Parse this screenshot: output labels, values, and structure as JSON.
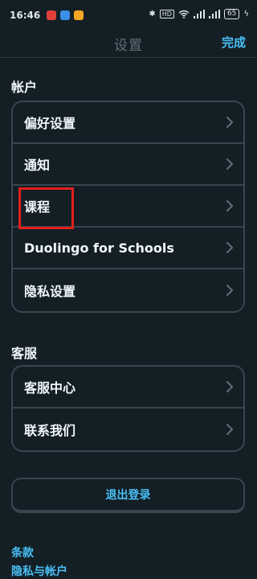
{
  "status_bar": {
    "time": "16:46",
    "network_label": "HD",
    "battery": "65"
  },
  "nav": {
    "title": "设置",
    "done_label": "完成"
  },
  "account": {
    "header": "帐户",
    "items": [
      {
        "label": "偏好设置"
      },
      {
        "label": "通知"
      },
      {
        "label": "课程"
      },
      {
        "label": "Duolingo for Schools"
      },
      {
        "label": "隐私设置"
      }
    ]
  },
  "support": {
    "header": "客服",
    "items": [
      {
        "label": "客服中心"
      },
      {
        "label": "联系我们"
      }
    ]
  },
  "logout_label": "退出登录",
  "links": [
    {
      "label": "条款"
    },
    {
      "label": "隐私与帐户"
    }
  ],
  "colors": {
    "background": "#141f25",
    "accent": "#49c0f8",
    "border": "#37464f",
    "highlight": "#e3201b"
  }
}
